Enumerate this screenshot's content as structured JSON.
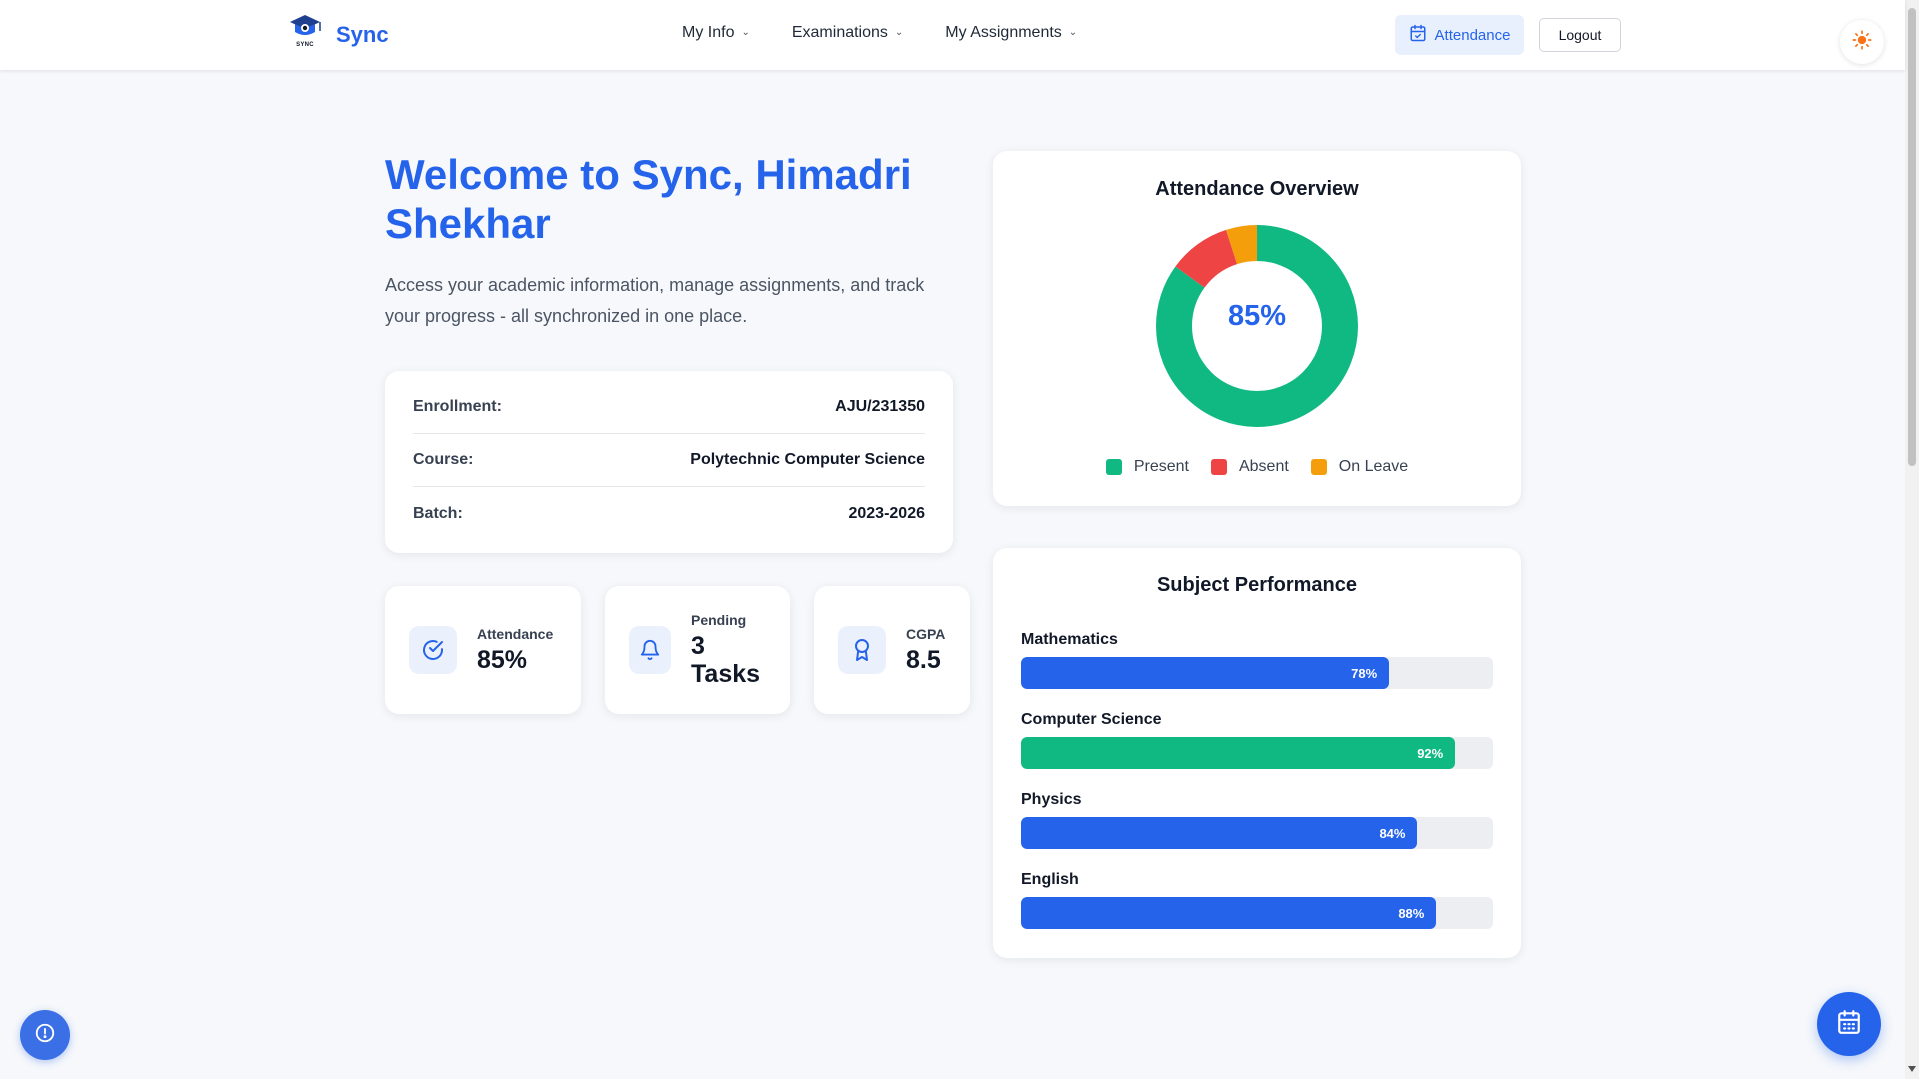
{
  "header": {
    "logo_text": "SYNC",
    "brand": "Sync",
    "nav": [
      {
        "label": "My Info"
      },
      {
        "label": "Examinations"
      },
      {
        "label": "My Assignments"
      }
    ],
    "attendance_label": "Attendance",
    "logout_label": "Logout"
  },
  "hero": {
    "title": "Welcome to Sync, Himadri Shekhar",
    "subtitle": "Access your academic information, manage assignments, and track your progress - all synchronized in one place."
  },
  "info": [
    {
      "label": "Enrollment:",
      "value": "AJU/231350"
    },
    {
      "label": "Course:",
      "value": "Polytechnic Computer Science"
    },
    {
      "label": "Batch:",
      "value": "2023-2026"
    }
  ],
  "stats": [
    {
      "label": "Attendance",
      "value": "85%",
      "icon": "check-circle-icon"
    },
    {
      "label": "Pending",
      "value": "3 Tasks",
      "icon": "bell-icon"
    },
    {
      "label": "CGPA",
      "value": "8.5",
      "icon": "award-icon"
    }
  ],
  "attendance_overview": {
    "title": "Attendance Overview",
    "center_label": "85%",
    "chart_data": {
      "type": "pie",
      "title": "Attendance Overview",
      "categories": [
        "Present",
        "Absent",
        "On Leave"
      ],
      "values": [
        85,
        10,
        5
      ],
      "colors": [
        "#10b981",
        "#ef4444",
        "#f59e0b"
      ],
      "legend": "bottom"
    }
  },
  "subject_performance": {
    "title": "Subject Performance",
    "chart_data": {
      "type": "bar",
      "orientation": "horizontal",
      "title": "Subject Performance",
      "categories": [
        "Mathematics",
        "Computer Science",
        "Physics",
        "English"
      ],
      "values": [
        78,
        92,
        84,
        88
      ],
      "value_labels": [
        "78%",
        "92%",
        "84%",
        "88%"
      ],
      "colors": [
        "#2563eb",
        "#10b981",
        "#2563eb",
        "#2563eb"
      ],
      "xlim": [
        0,
        100
      ]
    }
  },
  "colors": {
    "accent": "#2563eb",
    "present": "#10b981",
    "absent": "#ef4444",
    "leave": "#f59e0b"
  }
}
